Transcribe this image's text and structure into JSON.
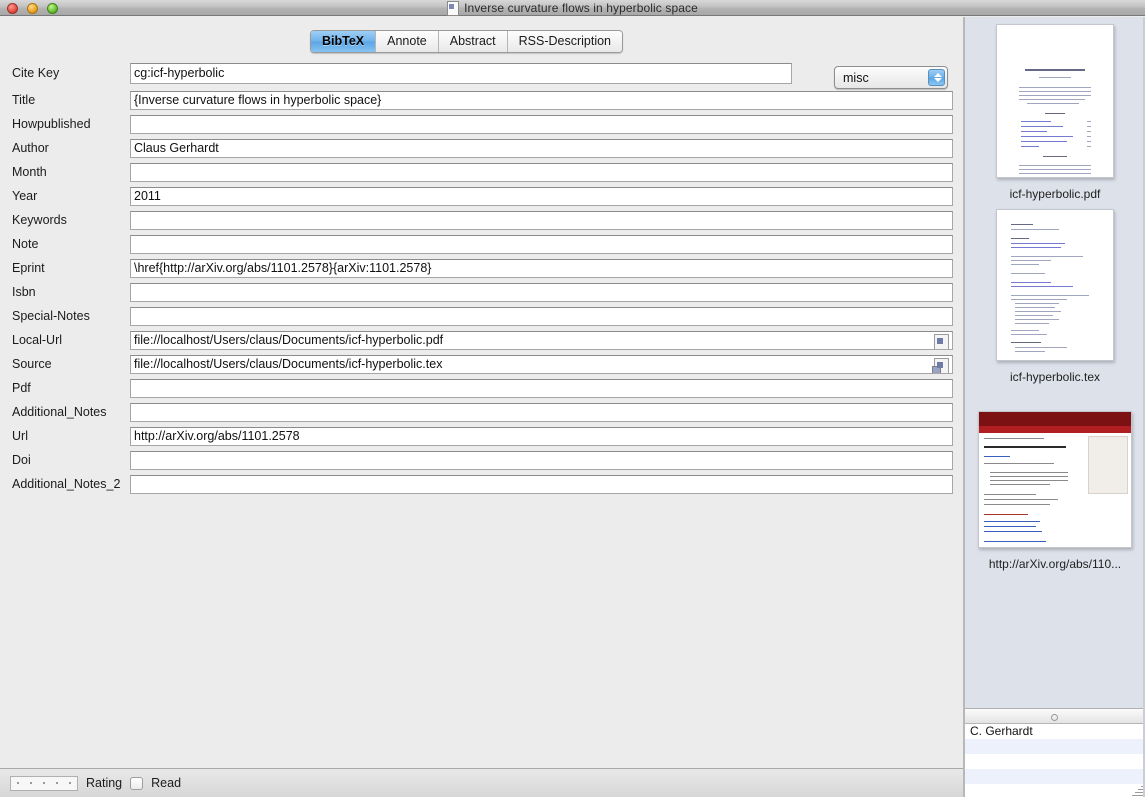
{
  "window": {
    "title": "Inverse curvature flows in hyperbolic space",
    "doc_icon": "document-icon",
    "controls": {
      "close": "close-button",
      "minimize": "minimize-button",
      "zoom": "zoom-button"
    }
  },
  "tabs": [
    {
      "label": "BibTeX",
      "active": true
    },
    {
      "label": "Annote",
      "active": false
    },
    {
      "label": "Abstract",
      "active": false
    },
    {
      "label": "RSS-Description",
      "active": false
    }
  ],
  "entry_type": {
    "label": "misc",
    "icon": "stepper-arrows-icon"
  },
  "fields": [
    {
      "label": "Cite Key",
      "value": "cg:icf-hyperbolic",
      "wide": false,
      "icon": null
    },
    {
      "label": "Title",
      "value": "{Inverse curvature flows in hyperbolic space}",
      "wide": true,
      "icon": null
    },
    {
      "label": "Howpublished",
      "value": "",
      "wide": true,
      "icon": null
    },
    {
      "label": "Author",
      "value": "Claus Gerhardt",
      "wide": true,
      "icon": null
    },
    {
      "label": "Month",
      "value": "",
      "wide": true,
      "icon": null
    },
    {
      "label": "Year",
      "value": "2011",
      "wide": true,
      "icon": null
    },
    {
      "label": "Keywords",
      "value": "",
      "wide": true,
      "icon": null
    },
    {
      "label": "Note",
      "value": "",
      "wide": true,
      "icon": null
    },
    {
      "label": "Eprint",
      "value": "\\href{http://arXiv.org/abs/1101.2578}{arXiv:1101.2578}",
      "wide": true,
      "icon": null
    },
    {
      "label": "Isbn",
      "value": "",
      "wide": true,
      "icon": null
    },
    {
      "label": "Special-Notes",
      "value": "",
      "wide": true,
      "icon": null
    },
    {
      "label": "Local-Url",
      "value": "file://localhost/Users/claus/Documents/icf-hyperbolic.pdf",
      "wide": true,
      "icon": "file-link-icon"
    },
    {
      "label": "Source",
      "value": "file://localhost/Users/claus/Documents/icf-hyperbolic.tex",
      "wide": true,
      "icon": "file-stack-icon"
    },
    {
      "label": "Pdf",
      "value": "",
      "wide": true,
      "icon": null
    },
    {
      "label": "Additional_Notes",
      "value": "",
      "wide": true,
      "icon": null
    },
    {
      "label": "Url",
      "value": "http://arXiv.org/abs/1101.2578",
      "wide": true,
      "icon": null
    },
    {
      "label": "Doi",
      "value": "",
      "wide": true,
      "icon": null
    },
    {
      "label": "Additional_Notes_2",
      "value": "",
      "wide": true,
      "icon": null
    }
  ],
  "bottom_bar": {
    "rating_label": "Rating",
    "rating_value": 0,
    "rating_max": 5,
    "read_label": "Read",
    "read_checked": false
  },
  "sidebar": {
    "attachments": [
      {
        "caption": "icf-hyperbolic.pdf",
        "kind": "pdf-page"
      },
      {
        "caption": "icf-hyperbolic.tex",
        "kind": "tex-source"
      },
      {
        "caption": "http://arXiv.org/abs/110...",
        "kind": "web-page"
      }
    ]
  },
  "author_pane": {
    "rows": [
      "C. Gerhardt",
      "",
      "",
      "",
      ""
    ],
    "resize_grip": "resize-grip-icon"
  },
  "colors": {
    "window_chrome": "#ececec",
    "sidebar_bg": "#dde1ea",
    "active_tab": "#6fb3ec",
    "field_bg": "#ffffff",
    "alt_row": "#edf1fb"
  }
}
